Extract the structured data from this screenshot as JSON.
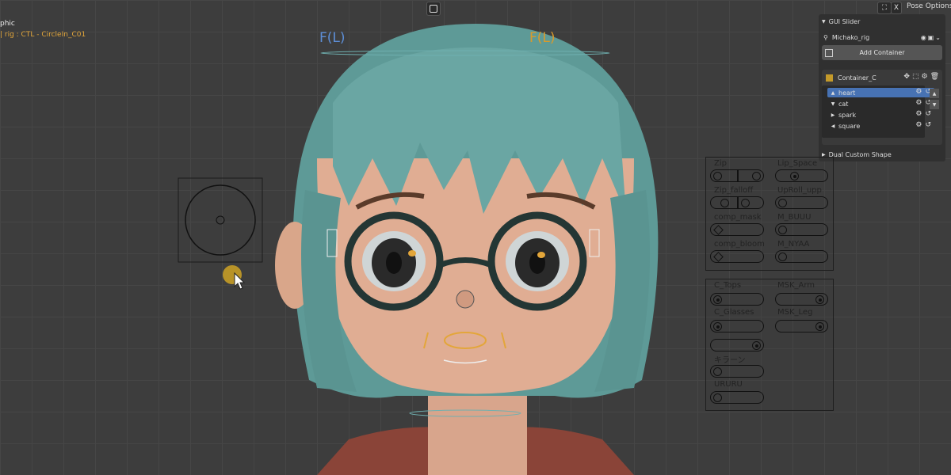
{
  "viewport": {
    "overlay_line1": "phic",
    "overlay_line2": "| rig : CTL - CircleIn_C01",
    "label_f_left": "F(L)",
    "label_f_right": "F(L)",
    "colors": {
      "f_left": "#5d8ed6",
      "f_right": "#d99a2b",
      "active": "#e3a63a"
    }
  },
  "header": {
    "camera_icon": "camera-icon",
    "close_label": "X",
    "pose_options_label": "Pose Options"
  },
  "npanel": {
    "section_title": "GUI Slider",
    "rig_name": "Michako_rig",
    "add_container_label": "Add Container",
    "container_name": "Container_C",
    "container_color": "#c49a2a",
    "items": [
      {
        "label": "heart",
        "selected": true
      },
      {
        "label": "cat",
        "selected": false
      },
      {
        "label": "spark",
        "selected": false
      },
      {
        "label": "square",
        "selected": false
      }
    ],
    "dual_section": "Dual Custom Shape"
  },
  "gui_top": {
    "labels": [
      "Zip",
      "Lip_Space",
      "Zip_falloff",
      "UpRoll_upp",
      "comp_mask",
      "M_BUUU",
      "comp_bloom",
      "M_NYAA"
    ]
  },
  "gui_bottom": {
    "labels": [
      "C_Tops",
      "MSK_Arm",
      "C_Glasses",
      "MSK_Leg",
      "キラーン",
      "URURU"
    ]
  }
}
